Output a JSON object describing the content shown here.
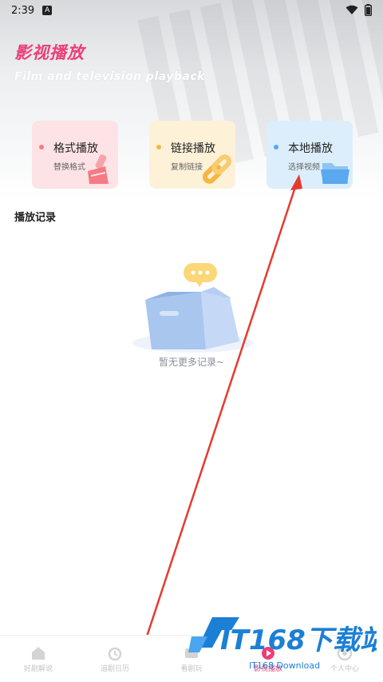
{
  "status": {
    "time": "2:39",
    "notif": "A"
  },
  "header": {
    "title": "影视播放",
    "subtitle": "Film and television playback"
  },
  "cards": [
    {
      "title": "格式播放",
      "sub": "替换格式",
      "bg": "#fde3e5",
      "dot": "#f47a84",
      "icon": "brush-icon"
    },
    {
      "title": "链接播放",
      "sub": "复制链接",
      "bg": "#fdf1d8",
      "dot": "#f5b742",
      "icon": "link-icon"
    },
    {
      "title": "本地播放",
      "sub": "选择视频",
      "bg": "#dceefc",
      "dot": "#5aa8ee",
      "icon": "folder-icon"
    }
  ],
  "history": {
    "title": "播放记录",
    "empty_text": "暂无更多记录~"
  },
  "tabs": [
    {
      "label": "好剧解说",
      "icon": "home-icon"
    },
    {
      "label": "追剧日历",
      "icon": "clock-icon"
    },
    {
      "label": "看剧玩",
      "icon": "tv-icon"
    },
    {
      "label": "影视播放",
      "icon": "play-icon"
    },
    {
      "label": "个人中心",
      "icon": "user-icon"
    }
  ],
  "active_tab": "影视播放",
  "watermark": {
    "brand": "IT168下载站",
    "sub": "IT168 Download"
  }
}
